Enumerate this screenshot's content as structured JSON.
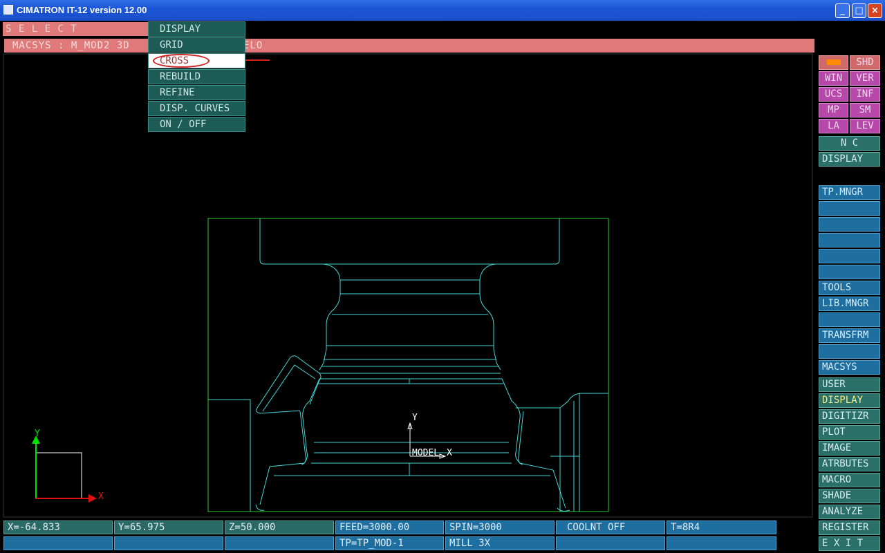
{
  "window": {
    "title": "CIMATRON IT-12 version 12.00",
    "controls": [
      "_",
      "□",
      "×"
    ]
  },
  "prompt": {
    "select": "S E L E C T",
    "status": "MACSYS : M_MOD2 3D",
    "status_tail": "ELO"
  },
  "menu": {
    "items": [
      {
        "label": "DISPLAY"
      },
      {
        "label": "GRID"
      },
      {
        "label": "CROSS"
      },
      {
        "label": "REBUILD"
      },
      {
        "label": "REFINE"
      },
      {
        "label": "DISP. CURVES"
      },
      {
        "label": "ON / OFF"
      }
    ],
    "selected": "CROSS"
  },
  "right_panel": {
    "top_grid": [
      [
        "",
        "SHD"
      ],
      [
        "WIN",
        "VER"
      ],
      [
        "UCS",
        "INF"
      ],
      [
        "MP",
        "SM"
      ],
      [
        "LA",
        "LEV"
      ]
    ],
    "nc": "N C",
    "nc_display": "DISPLAY",
    "tp_mngr": "TP.MNGR",
    "tools": "TOOLS",
    "lib_mngr": "LIB.MNGR",
    "transfrm": "TRANSFRM",
    "macsys": "MACSYS",
    "main": [
      {
        "label": "USER"
      },
      {
        "label": "DISPLAY",
        "active": true
      },
      {
        "label": "DIGITIZR"
      },
      {
        "label": "PLOT"
      },
      {
        "label": "IMAGE"
      },
      {
        "label": "ATRBUTES"
      },
      {
        "label": "MACRO"
      },
      {
        "label": "SHADE"
      },
      {
        "label": "ANALYZE"
      },
      {
        "label": "REGISTER"
      },
      {
        "label": "E X I T"
      }
    ]
  },
  "statusbar": {
    "x": "X=-64.833",
    "y": "Y=65.975",
    "z": "Z=50.000",
    "feed": "FEED=3000.00",
    "spin": "SPIN=3000",
    "coolnt": "COOLNT OFF",
    "t": "T=8R4",
    "tp": "TP=TP_MOD-1",
    "mill": "MILL 3X"
  },
  "axes": {
    "x": "X",
    "y": "Y",
    "model_label": "MODEL",
    "model_x": "X",
    "model_y": "Y"
  },
  "colors": {
    "pink": "#e07a7a",
    "teal": "#2a6f68",
    "blue": "#1e6fa0",
    "magenta": "#b548a9",
    "wire": "#44d6d6",
    "frame": "#2ecc2e"
  }
}
